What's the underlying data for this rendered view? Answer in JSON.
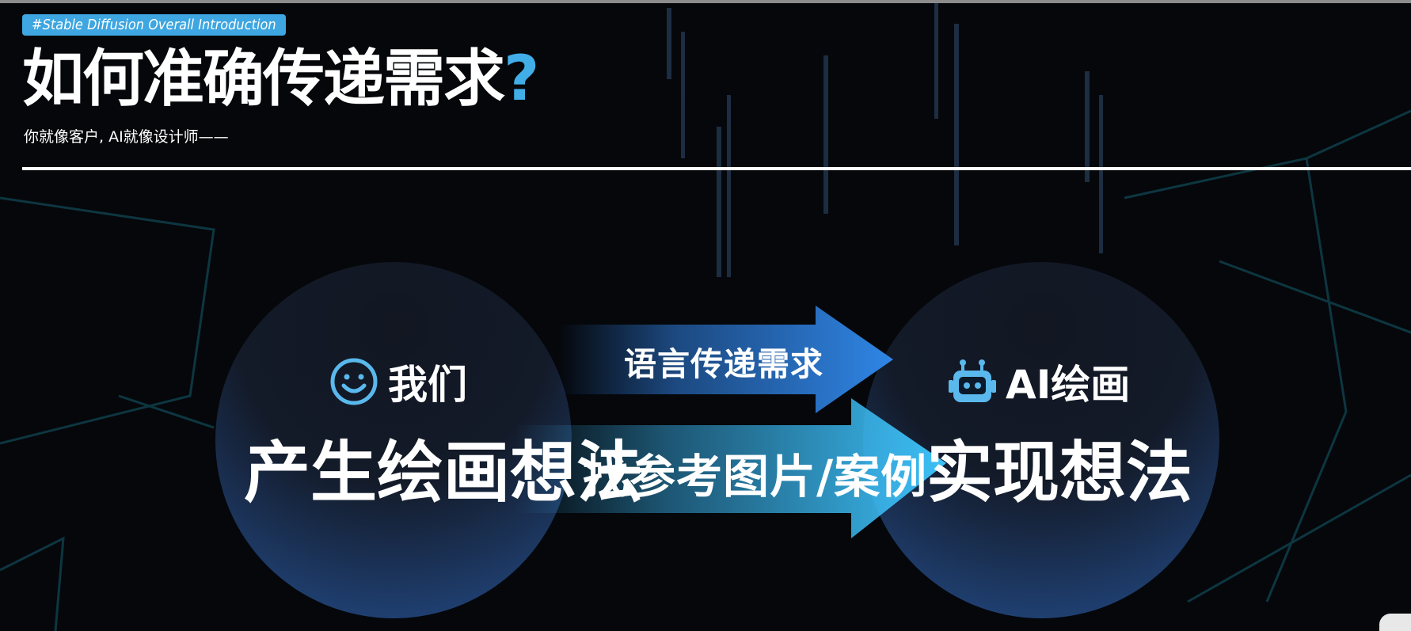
{
  "header": {
    "tag": "#Stable Diffusion Overall Introduction",
    "title": "如何准确传递需求",
    "title_mark": "?",
    "subtitle": "你就像客户, AI就像设计师——"
  },
  "left_node": {
    "actor": "我们",
    "action": "产生绘画想法",
    "icon": "smiley-icon"
  },
  "right_node": {
    "actor": "AI绘画",
    "action": "实现想法",
    "icon": "robot-icon"
  },
  "arrows": [
    {
      "label": "语言传递需求"
    },
    {
      "label": "找参考图片/案例"
    }
  ],
  "colors": {
    "accent": "#3ea6e0",
    "arrow_top": "#2f7fe0",
    "arrow_bottom": "#3ab6f2",
    "background": "#05070b"
  }
}
